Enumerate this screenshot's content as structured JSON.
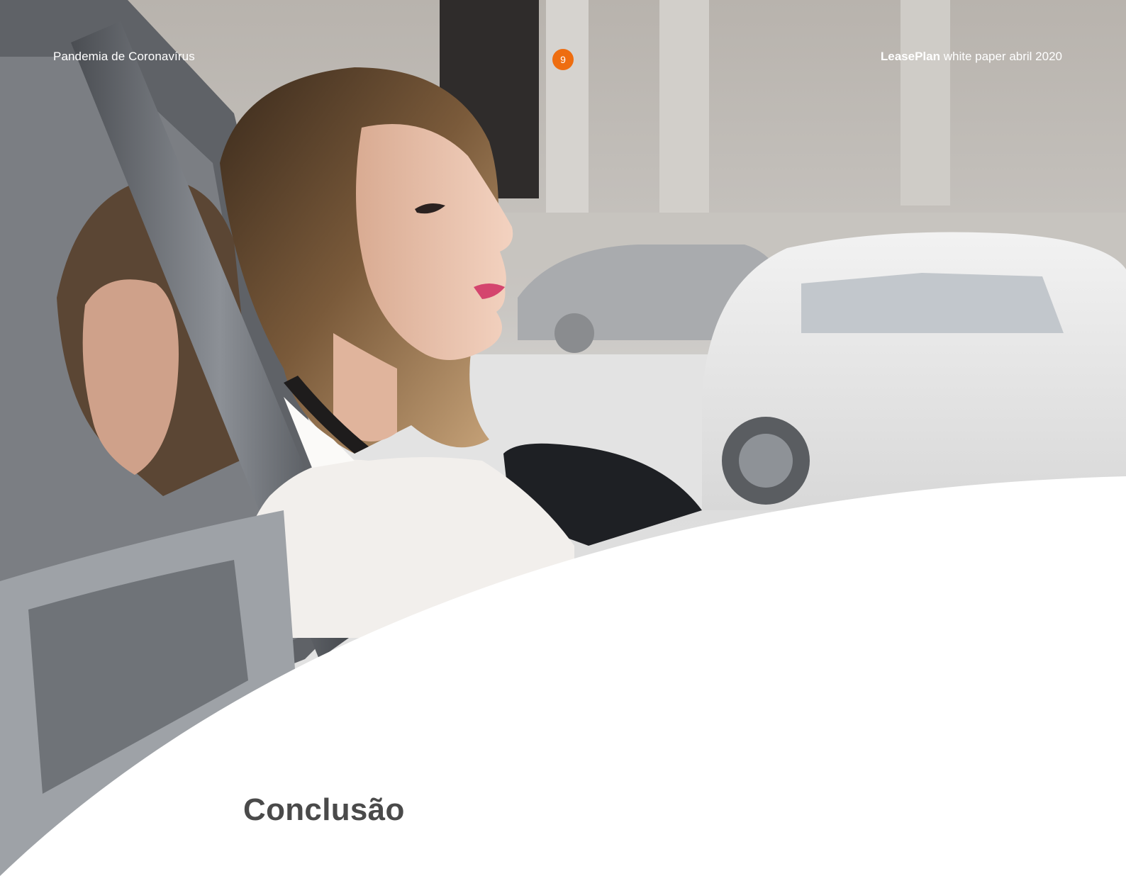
{
  "header": {
    "section_title": "Pandemia de Coronavírus",
    "page_number": "9",
    "brand": "LeasePlan",
    "publication": " white paper abril 2020"
  },
  "main": {
    "heading": "Conclusão"
  },
  "colors": {
    "accent": "#ee6d10",
    "heading_text": "#4a4a4a",
    "header_text": "#ffffff"
  }
}
